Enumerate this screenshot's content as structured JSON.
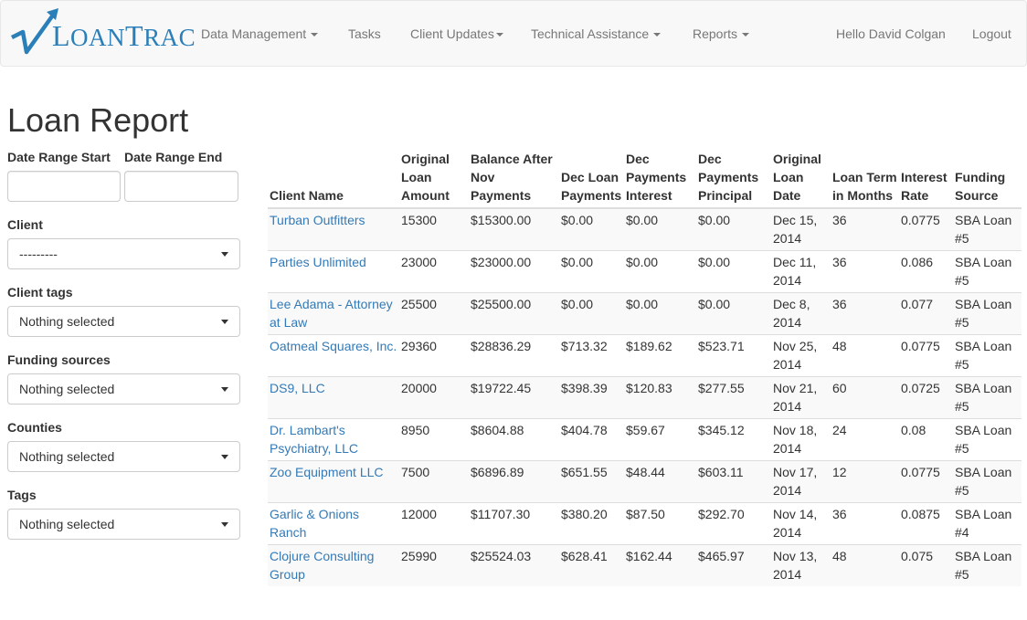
{
  "brand": {
    "first_letter": "L",
    "rest1": "OAN",
    "second_letter": "T",
    "rest2": "RAC"
  },
  "nav": {
    "data_management": "Data Management",
    "tasks": "Tasks",
    "client_updates": "Client Updates",
    "technical_assistance": "Technical Assistance",
    "reports": "Reports",
    "greeting": "Hello David Colgan",
    "logout": "Logout"
  },
  "page": {
    "title": "Loan Report"
  },
  "filters": {
    "date_start_label": "Date Range Start",
    "date_end_label": "Date Range End",
    "date_start_value": "",
    "date_end_value": "",
    "client_label": "Client",
    "client_value": "---------",
    "client_tags_label": "Client tags",
    "client_tags_value": "Nothing selected",
    "funding_sources_label": "Funding sources",
    "funding_sources_value": "Nothing selected",
    "counties_label": "Counties",
    "counties_value": "Nothing selected",
    "tags_label": "Tags",
    "tags_value": "Nothing selected"
  },
  "table": {
    "headers": [
      "Client Name",
      "Original Loan Amount",
      "Balance After Nov Payments",
      "Dec Loan Payments",
      "Dec Payments Interest",
      "Dec Payments Principal",
      "Original Loan Date",
      "Loan Term in Months",
      "Interest Rate",
      "Funding Source"
    ],
    "rows": [
      [
        "Turban Outfitters",
        "15300",
        "$15300.00",
        "$0.00",
        "$0.00",
        "$0.00",
        "Dec 15, 2014",
        "36",
        "0.0775",
        "SBA Loan #5"
      ],
      [
        "Parties Unlimited",
        "23000",
        "$23000.00",
        "$0.00",
        "$0.00",
        "$0.00",
        "Dec 11, 2014",
        "36",
        "0.086",
        "SBA Loan #5"
      ],
      [
        "Lee Adama - Attorney at Law",
        "25500",
        "$25500.00",
        "$0.00",
        "$0.00",
        "$0.00",
        "Dec 8, 2014",
        "36",
        "0.077",
        "SBA Loan #5"
      ],
      [
        "Oatmeal Squares, Inc.",
        "29360",
        "$28836.29",
        "$713.32",
        "$189.62",
        "$523.71",
        "Nov 25, 2014",
        "48",
        "0.0775",
        "SBA Loan #5"
      ],
      [
        "DS9, LLC",
        "20000",
        "$19722.45",
        "$398.39",
        "$120.83",
        "$277.55",
        "Nov 21, 2014",
        "60",
        "0.0725",
        "SBA Loan #5"
      ],
      [
        "Dr. Lambart's Psychiatry, LLC",
        "8950",
        "$8604.88",
        "$404.78",
        "$59.67",
        "$345.12",
        "Nov 18, 2014",
        "24",
        "0.08",
        "SBA Loan #5"
      ],
      [
        "Zoo Equipment LLC",
        "7500",
        "$6896.89",
        "$651.55",
        "$48.44",
        "$603.11",
        "Nov 17, 2014",
        "12",
        "0.0775",
        "SBA Loan #5"
      ],
      [
        "Garlic & Onions Ranch",
        "12000",
        "$11707.30",
        "$380.20",
        "$87.50",
        "$292.70",
        "Nov 14, 2014",
        "36",
        "0.0875",
        "SBA Loan #4"
      ],
      [
        "Clojure Consulting Group",
        "25990",
        "$25524.03",
        "$628.41",
        "$162.44",
        "$465.97",
        "Nov 13, 2014",
        "48",
        "0.075",
        "SBA Loan #5"
      ]
    ]
  },
  "colors": {
    "link": "#337ab7",
    "brand": "#2a7fb8",
    "navbar_bg": "#f8f8f8"
  }
}
